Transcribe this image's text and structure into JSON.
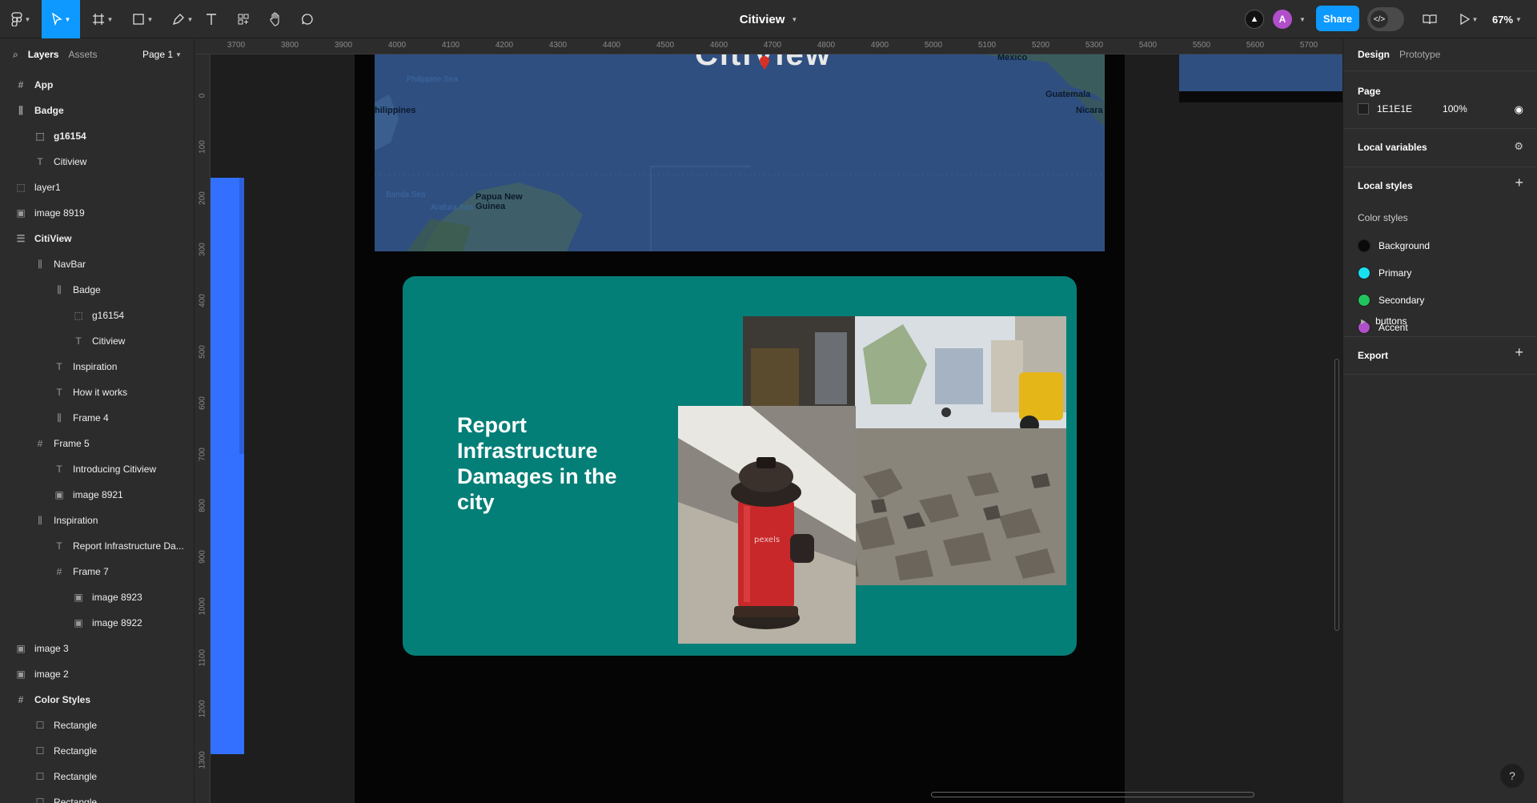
{
  "toolbar": {
    "file_title": "Citiview",
    "share_label": "Share",
    "avatar_initial": "A",
    "zoom_label": "67%",
    "accent": "#0d99ff"
  },
  "left_panel": {
    "tabs": [
      "Layers",
      "Assets"
    ],
    "page_select": "Page 1",
    "layers": [
      {
        "label": "App",
        "icon": "frame-icon"
      },
      {
        "label": "Badge",
        "icon": "auto-layout-icon"
      },
      {
        "label": "g16154",
        "icon": "group-icon"
      },
      {
        "label": "Citiview",
        "icon": "text-icon"
      },
      {
        "label": "layer1",
        "icon": "group-icon"
      },
      {
        "label": "image 8919",
        "icon": "image-icon"
      },
      {
        "label": "CitiView",
        "icon": "auto-layout-vertical-icon"
      },
      {
        "label": "NavBar",
        "icon": "auto-layout-icon"
      },
      {
        "label": "Badge",
        "icon": "auto-layout-icon"
      },
      {
        "label": "g16154",
        "icon": "group-icon"
      },
      {
        "label": "Citiview",
        "icon": "text-icon"
      },
      {
        "label": "Inspiration",
        "icon": "text-icon"
      },
      {
        "label": "How it works",
        "icon": "text-icon"
      },
      {
        "label": "Frame 4",
        "icon": "auto-layout-icon"
      },
      {
        "label": "Frame 5",
        "icon": "frame-icon"
      },
      {
        "label": "Introducing Citiview",
        "icon": "text-icon"
      },
      {
        "label": "image 8921",
        "icon": "image-icon"
      },
      {
        "label": "Inspiration",
        "icon": "auto-layout-icon"
      },
      {
        "label": "Report Infrastructure Da...",
        "icon": "text-icon"
      },
      {
        "label": "Frame 7",
        "icon": "frame-icon"
      },
      {
        "label": "image 8923",
        "icon": "image-icon"
      },
      {
        "label": "image 8922",
        "icon": "image-icon"
      },
      {
        "label": "image 3",
        "icon": "image-icon"
      },
      {
        "label": "image 2",
        "icon": "image-icon"
      },
      {
        "label": "Color Styles",
        "icon": "frame-icon"
      },
      {
        "label": "Rectangle",
        "icon": "rectangle-icon"
      },
      {
        "label": "Rectangle",
        "icon": "rectangle-icon"
      },
      {
        "label": "Rectangle",
        "icon": "rectangle-icon"
      },
      {
        "label": "Rectangle",
        "icon": "rectangle-icon"
      }
    ]
  },
  "canvas": {
    "ruler_top": [
      "3700",
      "3800",
      "3900",
      "4000",
      "4100",
      "4200",
      "4300",
      "4400",
      "4500",
      "4600",
      "4700",
      "4800",
      "4900",
      "5000",
      "5100",
      "5200",
      "5300",
      "5400",
      "5500",
      "5600",
      "5700"
    ],
    "ruler_left": [
      "0",
      "100",
      "200",
      "300",
      "400",
      "500",
      "600",
      "700",
      "800",
      "900",
      "1000",
      "1100",
      "1200",
      "1300"
    ],
    "map_labels": {
      "philippines": "hilippines",
      "papua": "Papua New Guinea",
      "mexico": "Mexico",
      "guatemala": "Guatemala",
      "nicaragua": "Nicara",
      "sea1": "Philippine Sea",
      "sea2": "Banda Sea",
      "sea3": "Arafura Sea"
    },
    "card_heading": "Report Infrastructure Damages in the city",
    "watermark": "pexels",
    "card_color": "#047f77"
  },
  "right_panel": {
    "tabs": [
      "Design",
      "Prototype"
    ],
    "page_heading": "Page",
    "page_color_hex": "1E1E1E",
    "page_opacity": "100%",
    "local_variables": "Local variables",
    "local_styles": "Local styles",
    "color_styles_heading": "Color styles",
    "color_styles": [
      {
        "name": "Background",
        "color": "#0a0a0a"
      },
      {
        "name": "Primary",
        "color": "#19e0f0"
      },
      {
        "name": "Secondary",
        "color": "#21c55d"
      },
      {
        "name": "Accent",
        "color": "#b04fc9"
      }
    ],
    "buttons_group": "buttons",
    "export": "Export"
  },
  "help_label": "?"
}
